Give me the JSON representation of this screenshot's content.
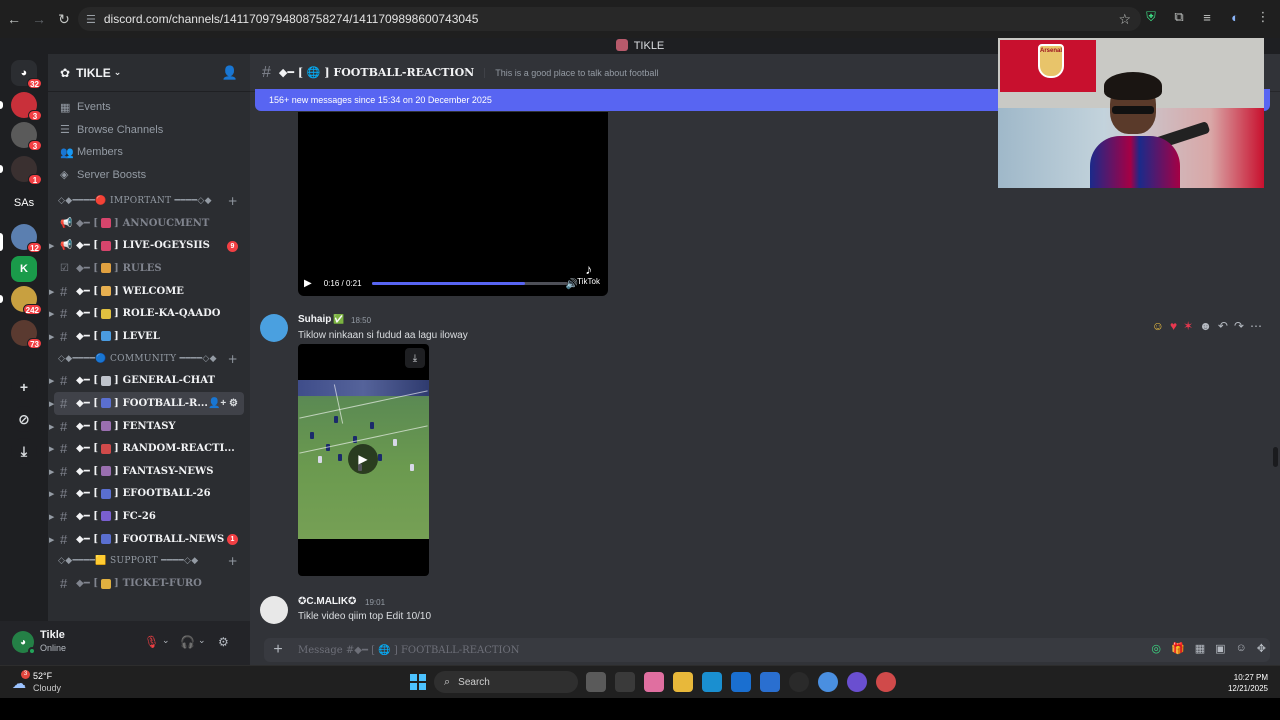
{
  "browser": {
    "url": "discord.com/channels/1411709794808758274/1411709898600743045"
  },
  "window": {
    "title": "TIKLE"
  },
  "guilds": {
    "items": [
      {
        "name": "direct-messages",
        "badge": "32",
        "color": "#2b2d31"
      },
      {
        "name": "server-red",
        "badge": "3",
        "color": "#c9303a"
      },
      {
        "name": "server-photo-1",
        "badge": "3",
        "color": "#5a5a5a"
      },
      {
        "name": "server-photo-2",
        "badge": "1",
        "color": "#3a3030"
      },
      {
        "name": "SAs",
        "badge": "",
        "color": "#1e1f22"
      },
      {
        "name": "server-active",
        "badge": "12",
        "color": "#5b7fb0"
      },
      {
        "name": "server-green",
        "badge": "",
        "color": "#1a9b4a"
      },
      {
        "name": "server-yellow",
        "badge": "242",
        "color": "#c8a040"
      },
      {
        "name": "server-photo-3",
        "badge": "73",
        "color": "#5a3a30"
      }
    ],
    "sas_label": "SAs"
  },
  "server": {
    "name": "TIKLE",
    "menu": [
      {
        "icon": "calendar",
        "label": "Events"
      },
      {
        "icon": "browse",
        "label": "Browse Channels"
      },
      {
        "icon": "members",
        "label": "Members"
      },
      {
        "icon": "boost",
        "label": "Server Boosts"
      }
    ],
    "categories": [
      {
        "label": "◇◆━━━━🔴 IMPORTANT ━━━━◇◆",
        "channels": [
          {
            "label": "ANNOUCMENT",
            "icon": "megaphone",
            "emoji_color": "#d6456c",
            "muted": true,
            "badge": ""
          },
          {
            "label": "LIVE-OGEYSIIS",
            "icon": "megaphone",
            "emoji_color": "#d6456c",
            "muted": false,
            "badge": "9"
          },
          {
            "label": "RULES",
            "icon": "rules",
            "emoji_color": "#e0a040",
            "muted": true,
            "badge": ""
          },
          {
            "label": "WELCOME",
            "icon": "hash",
            "emoji_color": "#e8b050",
            "muted": false,
            "badge": ""
          },
          {
            "label": "ROLE-KA-QAADO",
            "icon": "hash",
            "emoji_color": "#e0c040",
            "muted": false,
            "badge": ""
          },
          {
            "label": "LEVEL",
            "icon": "hash",
            "emoji_color": "#4a9be0",
            "muted": false,
            "badge": ""
          }
        ]
      },
      {
        "label": "◇◆━━━━🔵 COMMUNITY ━━━━◇◆",
        "channels": [
          {
            "label": "GENERAL-CHAT",
            "icon": "hash",
            "emoji_color": "#c0c4cc",
            "muted": false,
            "badge": ""
          },
          {
            "label": "FOOTBALL-R...",
            "icon": "hash",
            "emoji_color": "#5a6fd0",
            "muted": false,
            "badge": "",
            "active": true
          },
          {
            "label": "FENTASY",
            "icon": "hash",
            "emoji_color": "#9a6fb0",
            "muted": false,
            "badge": ""
          },
          {
            "label": "RANDOM-REACTI...",
            "icon": "hash",
            "emoji_color": "#d04a4a",
            "muted": false,
            "badge": ""
          },
          {
            "label": "FANTASY-NEWS",
            "icon": "hash",
            "emoji_color": "#9a6fb0",
            "muted": false,
            "badge": ""
          },
          {
            "label": "EFOOTBALL-26",
            "icon": "hash",
            "emoji_color": "#5a6fd0",
            "muted": false,
            "badge": ""
          },
          {
            "label": "FC-26",
            "icon": "hash",
            "emoji_color": "#7a5fd0",
            "muted": false,
            "badge": ""
          },
          {
            "label": "FOOTBALL-NEWS",
            "icon": "hash",
            "emoji_color": "#5a6fd0",
            "muted": false,
            "badge": "1"
          }
        ]
      },
      {
        "label": "◇◆━━━━🟨 SUPPORT ━━━━◇◆",
        "channels": [
          {
            "label": "TICKET-FURO",
            "icon": "hash",
            "emoji_color": "#e0b040",
            "muted": true,
            "badge": ""
          }
        ]
      }
    ],
    "channel_prefix": "◆━ [",
    "channel_suffix": "]"
  },
  "user": {
    "name": "Tikle",
    "status": "Online",
    "initial": "T"
  },
  "channel": {
    "name": "◆━ [ 🌐 ] FOOTBALL-REACTION",
    "topic": "This is a good place to talk about football",
    "new_messages": "156+ new messages since 15:34 on 20 December 2025"
  },
  "video1": {
    "time": "0:16 / 0:21",
    "progress": 0.78,
    "watermark": "TikTok"
  },
  "messages": [
    {
      "author": "Suhaip",
      "badge": "✅",
      "time": "18:50",
      "text": "Tiklow ninkaan si fudud aa lagu  iloway",
      "avatar_color": "#4aa0e0"
    },
    {
      "author": "✪C.MALIK✪",
      "time": "19:01",
      "text": "Tikle video qiim top Edit 10/10",
      "avatar_color": "#e8e8e8"
    }
  ],
  "composer": {
    "placeholder": "Message #◆━ [ 🌐 ] FOOTBALL-REACTION"
  },
  "taskbar": {
    "temp": "52°F",
    "condition": "Cloudy",
    "weather_badge": "3",
    "search": "Search",
    "time": "10:27 PM",
    "date": "12/21/2025",
    "apps": [
      "#5a5a5a",
      "#3a3a3a",
      "#e06fa0",
      "#e8b83a",
      "#1a8fd0",
      "#1a6fd0",
      "#2a6fd0",
      "#2a2a2a",
      "#4a8fe0",
      "#6a4fd0",
      "#d04a4a"
    ]
  },
  "webcam": {
    "flag_text": "Arsenal"
  }
}
